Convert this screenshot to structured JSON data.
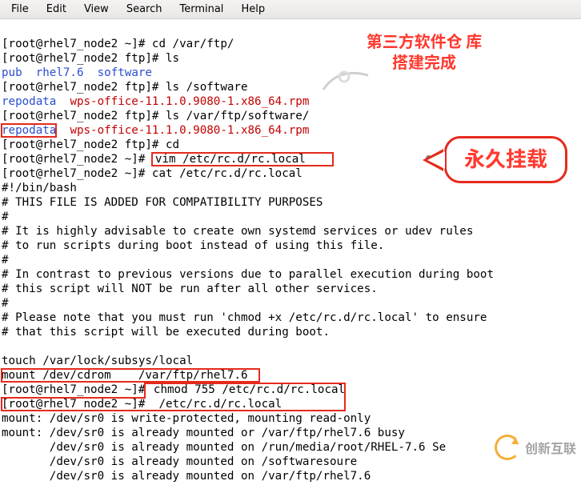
{
  "menubar": {
    "file": "File",
    "edit": "Edit",
    "view": "View",
    "search": "Search",
    "terminal": "Terminal",
    "help": "Help"
  },
  "prompt": {
    "node_home": "[root@rhel7_node2 ~]#",
    "node_ftp": "[root@rhel7_node2 ftp]#"
  },
  "cmd": {
    "cd_varftp": "cd /var/ftp/",
    "ls": "ls",
    "ls_software": "ls /software",
    "ls_varftp_software": "ls /var/ftp/software/",
    "cd": "cd",
    "vim_rclocal": "vim /etc/rc.d/rc.local",
    "cat_rclocal": "cat /etc/rc.d/rc.local",
    "chmod_rclocal": "chmod 755 /etc/rc.d/rc.local",
    "run_rclocal": "/etc/rc.d/rc.local"
  },
  "ls1": {
    "pub": "pub",
    "rhel76": "rhel7.6",
    "software": "software"
  },
  "ls2": {
    "repodata": "repodata",
    "wps": "wps-office-11.1.0.9080-1.x86_64.rpm"
  },
  "rclocal": {
    "shebang": "#!/bin/bash",
    "l1": "# THIS FILE IS ADDED FOR COMPATIBILITY PURPOSES",
    "l2": "#",
    "l3": "# It is highly advisable to create own systemd services or udev rules",
    "l4": "# to run scripts during boot instead of using this file.",
    "l5": "#",
    "l6": "# In contrast to previous versions due to parallel execution during boot",
    "l7": "# this script will NOT be run after all other services.",
    "l8": "#",
    "l9": "# Please note that you must run 'chmod +x /etc/rc.d/rc.local' to ensure",
    "l10": "# that this script will be executed during boot.",
    "touch": "touch /var/lock/subsys/local",
    "mount": "mount /dev/cdrom    /var/ftp/rhel7.6"
  },
  "mountout": {
    "m1": "mount: /dev/sr0 is write-protected, mounting read-only",
    "m2": "mount: /dev/sr0 is already mounted or /var/ftp/rhel7.6 busy",
    "m3": "       /dev/sr0 is already mounted on /run/media/root/RHEL-7.6 Se",
    "m4": "       /dev/sr0 is already mounted on /softwaresoure",
    "m5": "       /dev/sr0 is already mounted on /var/ftp/rhel7.6"
  },
  "annot": {
    "top": "第三方软件仓\n库搭建完成",
    "arrow": "永久挂载"
  },
  "watermark": "创新互联"
}
